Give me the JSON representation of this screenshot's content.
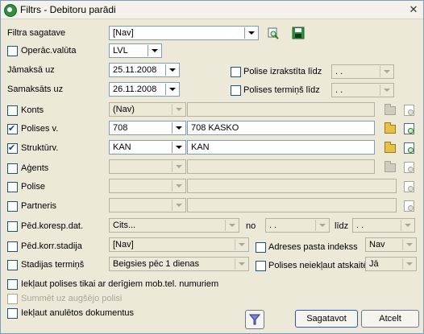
{
  "window": {
    "title": "Filtrs - Debitoru parādi",
    "close_glyph": "✕"
  },
  "form": {
    "filtra_sagatave": {
      "label": "Filtra sagatave",
      "value": "[Nav]"
    },
    "operac_valuta": {
      "label": "Operāc.valūta",
      "checked": false,
      "value": "LVL"
    },
    "jamaksa_uz": {
      "label": "Jāmaksā uz",
      "value": "25.11.2008"
    },
    "samaksats_uz": {
      "label": "Samaksāts uz",
      "value": "26.11.2008"
    },
    "polise_izrakstita": {
      "label": "Polise izrakstīta līdz",
      "checked": false,
      "value": " .  . "
    },
    "polises_termins": {
      "label": "Polises termiņš līdz",
      "checked": false,
      "value": " .  . "
    },
    "konts": {
      "label": "Konts",
      "checked": false,
      "value": "(Nav)",
      "desc": ""
    },
    "polises_v": {
      "label": "Polises v.",
      "checked": true,
      "value": "708",
      "desc": "708 KASKO"
    },
    "strukturv": {
      "label": "Struktūrv.",
      "checked": true,
      "value": "KAN",
      "desc": "KAN"
    },
    "agents": {
      "label": "Aģents",
      "checked": false,
      "value": "",
      "desc": ""
    },
    "polise": {
      "label": "Polise",
      "checked": false,
      "value": "",
      "desc": ""
    },
    "partneris": {
      "label": "Partneris",
      "checked": false,
      "value": "",
      "desc": ""
    },
    "ped_koresp": {
      "label": "Pēd.koresp.dat.",
      "checked": false,
      "value": "Cits...",
      "no_label": "no",
      "no_value": " .  . ",
      "lidz_label": "līdz",
      "lidz_value": " .  . "
    },
    "ped_korr_stadija": {
      "label": "Pēd.korr.stadija",
      "checked": false,
      "value": "[Nav]"
    },
    "adreses_pasta": {
      "label": "Adreses pasta indekss",
      "checked": false,
      "value": "Nav"
    },
    "stadijas_termins": {
      "label": "Stadijas termiņš",
      "checked": false,
      "value": "Beigsies pēc 1 dienas"
    },
    "polises_neieklaut": {
      "label": "Polises neiekļaut atskaitē",
      "checked": false,
      "value": "Jā"
    },
    "ieklaut_mob": {
      "label": "Iekļaut polises tikai ar derīgiem mob.tel. numuriem",
      "checked": false
    },
    "summet": {
      "label": "Summēt uz augšējo polisi",
      "checked": false
    },
    "anuletos": {
      "label": "Iekļaut anulētos dokumentus",
      "checked": false
    }
  },
  "buttons": {
    "sagatavot": "Sagatavot",
    "atcelt": "Atcelt"
  }
}
